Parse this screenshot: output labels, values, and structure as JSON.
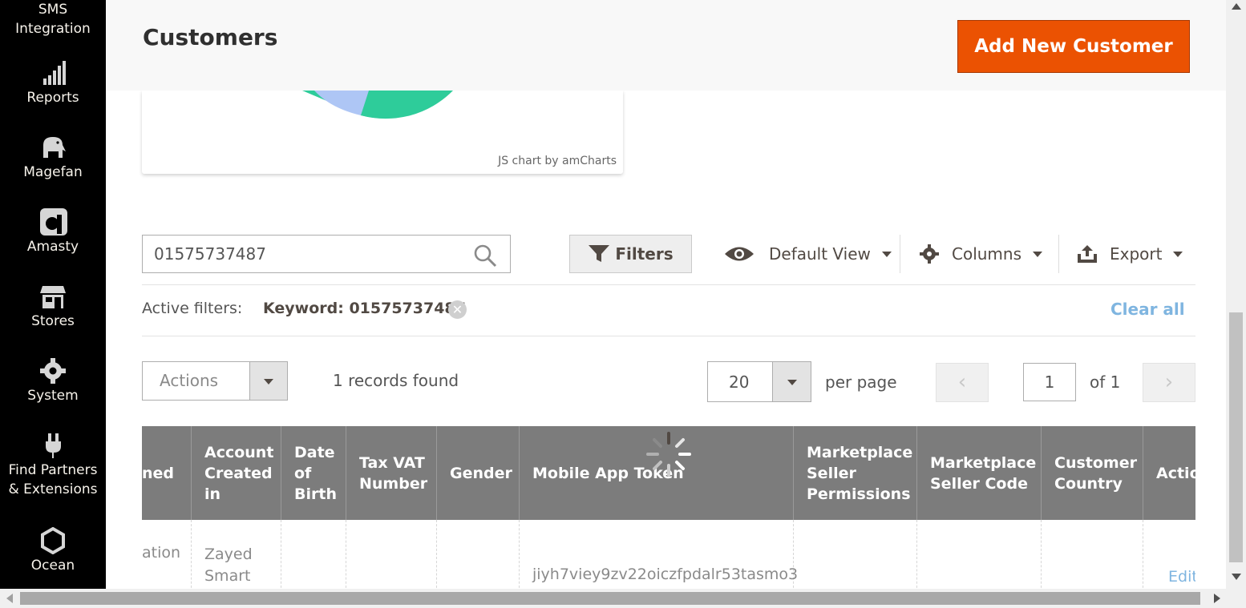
{
  "sidebar": {
    "items": [
      {
        "label": "SMS\nIntegration",
        "icon": "sms-icon"
      },
      {
        "label": "Reports",
        "icon": "bar-chart-icon"
      },
      {
        "label": "Magefan",
        "icon": "elephant-icon"
      },
      {
        "label": "Amasty",
        "icon": "amasty-logo-icon"
      },
      {
        "label": "Stores",
        "icon": "storefront-icon"
      },
      {
        "label": "System",
        "icon": "gear-icon"
      },
      {
        "label": "Find Partners\n& Extensions",
        "icon": "plug-icon"
      },
      {
        "label": "Ocean",
        "icon": "hexagon-icon"
      }
    ]
  },
  "header": {
    "title": "Customers",
    "add_button": "Add New Customer"
  },
  "chart_card": {
    "credit": "JS chart by amCharts"
  },
  "toolbar": {
    "search_value": "01575737487",
    "filters_label": "Filters",
    "default_view_label": "Default View",
    "columns_label": "Columns",
    "export_label": "Export"
  },
  "active_filters": {
    "label": "Active filters:",
    "keyword_chip": "Keyword: 01575737487",
    "clear_all": "Clear all"
  },
  "paging": {
    "actions_label": "Actions",
    "records_found": "1 records found",
    "per_page_value": "20",
    "per_page_label": "per page",
    "current_page": "1",
    "of_pages": "of 1",
    "prev": "‹",
    "next": "›"
  },
  "grid": {
    "columns": [
      "ned",
      "Account\nCreated\nin",
      "Date\nof\nBirth",
      "Tax VAT\nNumber",
      "Gender",
      "Mobile App Token",
      "Marketplace\nSeller\nPermissions",
      "Marketplace\nSeller Code",
      "Customer\nCountry",
      "Actio"
    ],
    "row": {
      "c0": "ation",
      "c1": "Zayed\nSmart",
      "c5": "jiyh7viey9zv22oiczfpdalr53tasmo3",
      "c9": "Edit"
    }
  },
  "colors": {
    "accent": "#eb5202",
    "sidebar_bg": "#000000",
    "grid_header_bg": "#7c7c7c",
    "link": "#7fb5e0"
  }
}
